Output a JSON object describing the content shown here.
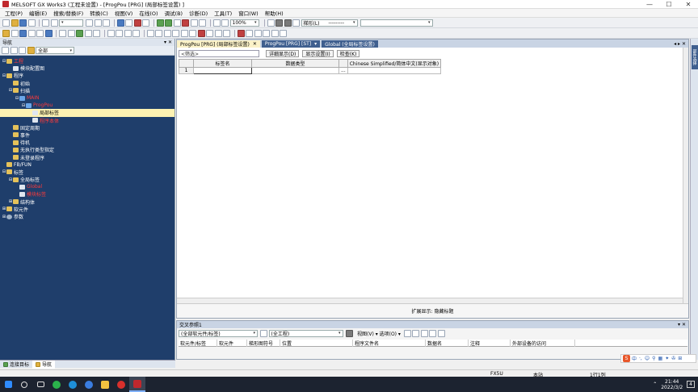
{
  "window": {
    "title": "MELSOFT GX Works3 (工程未设置) - [ProgPou [PRG] (局部标签设置) ]",
    "minimize": "—",
    "maximize": "☐",
    "close": "✕"
  },
  "menu": [
    "工程(P)",
    "编辑(E)",
    "搜索/替换(F)",
    "转换(C)",
    "视图(V)",
    "在线(O)",
    "调试(B)",
    "诊断(D)",
    "工具(T)",
    "窗口(W)",
    "帮助(H)"
  ],
  "toolbar": {
    "zoom": "100%",
    "zoom_arrow": "▾",
    "mode_combo": "梯形(L)",
    "mode_combo_suffix": "---------",
    "mode_arrow": "▾",
    "device_combo": "",
    "device_arrow": "▾"
  },
  "navigation": {
    "title": "导航",
    "pin": "▾ ✕",
    "filter_combo": "全部",
    "filter_arrow": "▾",
    "tree": [
      {
        "label": "工程",
        "exp": "⊟",
        "indent": 0,
        "icon": "fold",
        "red": true
      },
      {
        "label": "模块配置图",
        "exp": "",
        "indent": 1,
        "icon": "doc"
      },
      {
        "label": "程序",
        "exp": "⊟",
        "indent": 0,
        "icon": "fold"
      },
      {
        "label": "初始",
        "exp": "",
        "indent": 1,
        "icon": "fold"
      },
      {
        "label": "扫描",
        "exp": "⊟",
        "indent": 1,
        "icon": "fold"
      },
      {
        "label": "MAIN",
        "exp": "⊟",
        "indent": 2,
        "icon": "prog",
        "red": true
      },
      {
        "label": "ProgPou",
        "exp": "⊟",
        "indent": 3,
        "icon": "prog",
        "red": true
      },
      {
        "label": "局部标签",
        "exp": "",
        "indent": 4,
        "icon": "doc",
        "selected": true
      },
      {
        "label": "程序本体",
        "exp": "",
        "indent": 4,
        "icon": "doc",
        "red": true
      },
      {
        "label": "固定周期",
        "exp": "",
        "indent": 1,
        "icon": "fold"
      },
      {
        "label": "事件",
        "exp": "",
        "indent": 1,
        "icon": "fold"
      },
      {
        "label": "待机",
        "exp": "",
        "indent": 1,
        "icon": "fold"
      },
      {
        "label": "无执行类型指定",
        "exp": "",
        "indent": 1,
        "icon": "fold"
      },
      {
        "label": "未登录程序",
        "exp": "",
        "indent": 1,
        "icon": "fold"
      },
      {
        "label": "FB/FUN",
        "exp": "",
        "indent": 0,
        "icon": "fold"
      },
      {
        "label": "标签",
        "exp": "⊟",
        "indent": 0,
        "icon": "fold"
      },
      {
        "label": "全局标签",
        "exp": "⊟",
        "indent": 1,
        "icon": "fold"
      },
      {
        "label": "Global",
        "exp": "",
        "indent": 2,
        "icon": "doc",
        "red": true
      },
      {
        "label": "模块标签",
        "exp": "",
        "indent": 2,
        "icon": "doc",
        "red": true
      },
      {
        "label": "结构体",
        "exp": "⊞",
        "indent": 1,
        "icon": "fold"
      },
      {
        "label": "软元件",
        "exp": "⊞",
        "indent": 0,
        "icon": "fold"
      },
      {
        "label": "参数",
        "exp": "⊞",
        "indent": 0,
        "icon": "gear"
      }
    ],
    "footer_tabs": [
      "连接目标",
      "导航"
    ]
  },
  "editor": {
    "tabs": [
      {
        "label": "ProgPou [PRG] (局部标签设置)",
        "active": true,
        "close": "✕"
      },
      {
        "label": "ProgPou [PRG] [ST]",
        "active": false,
        "close": "▾"
      },
      {
        "label": "Global (全局标签设置)",
        "active": false,
        "close": ""
      }
    ],
    "tab_arrows": "◂ ▸ ✕",
    "filter_placeholder": "<筛选>",
    "detail_button": "详细显示(D)",
    "setting_button": "显示设置(I)",
    "check_button": "检查(K)",
    "grid_columns": [
      "",
      "标签名",
      "数据类型",
      "",
      "Chinese Simplified/简体中文(显示对象)"
    ],
    "grid_rows": [
      {
        "no": "1",
        "name": "",
        "type": "",
        "more": "...",
        "comment": ""
      }
    ],
    "footer": "扩展显示: 隐藏标题"
  },
  "side_panel": {
    "label": "部件选择"
  },
  "xref": {
    "title": "交叉参照1",
    "pin": "▾ ✕",
    "scope_combo": "(全部软元件/标签)",
    "scope_arrow": "▾",
    "range_combo": "(全工程)",
    "range_arrow": "▾",
    "view_label": "视图(V) ▾ 选项(O) ▾",
    "columns": [
      "软元件/标签",
      "软元件",
      "梯形图符号",
      "位置",
      "程序文件名",
      "数据名",
      "注释",
      "外部设备的访问"
    ]
  },
  "status": {
    "cpu": "FX5U",
    "station": "本站",
    "row": "1行1列"
  },
  "ime": {
    "logo": "S",
    "lang": "中",
    "items": [
      "·,",
      "☺",
      "⚲",
      "▦",
      "✦",
      "✇",
      "⊞"
    ]
  },
  "taskbar": {
    "time": "21:44",
    "date": "2022/3/2",
    "notify": "4"
  }
}
